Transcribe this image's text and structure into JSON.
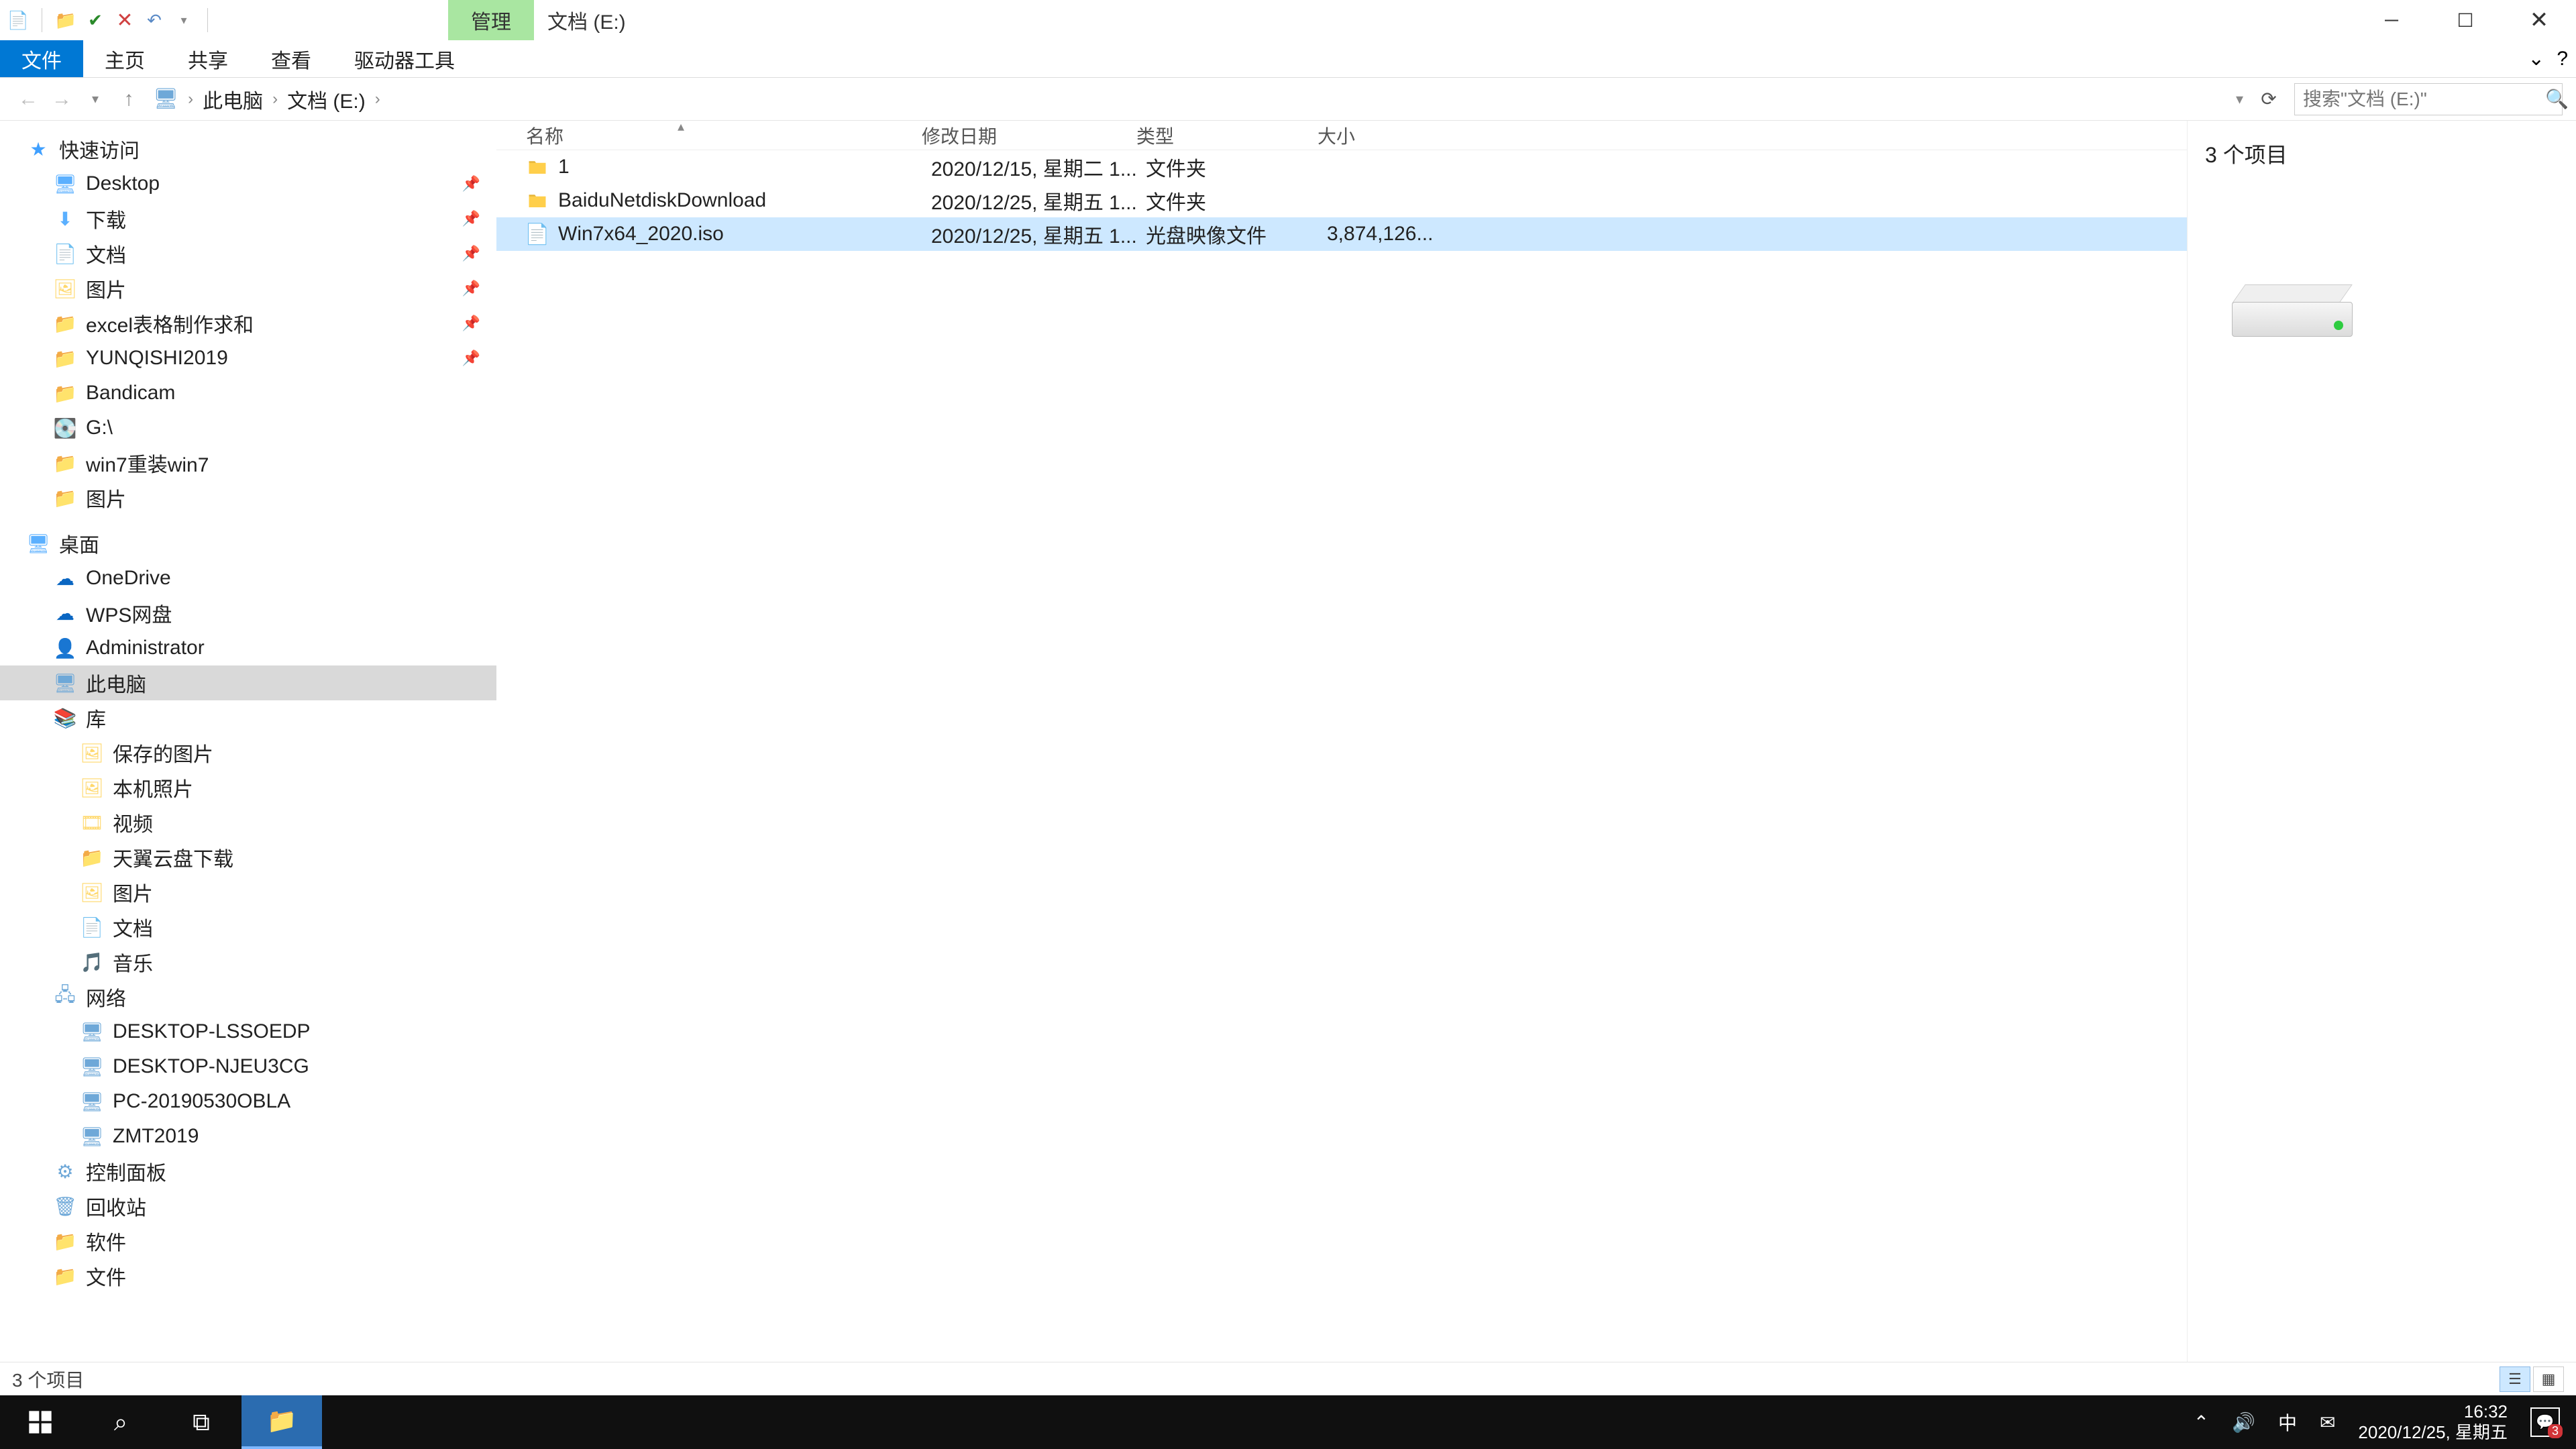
{
  "titlebar": {
    "contextual_tab": "管理",
    "window_title": "文档 (E:)"
  },
  "ribbon": {
    "file": "文件",
    "home": "主页",
    "share": "共享",
    "view": "查看",
    "drive_tools": "驱动器工具"
  },
  "breadcrumb": {
    "this_pc": "此电脑",
    "location": "文档 (E:)"
  },
  "search": {
    "placeholder": "搜索\"文档 (E:)\""
  },
  "tree": {
    "quick_access": "快速访问",
    "desktop": "Desktop",
    "downloads": "下载",
    "documents": "文档",
    "pictures": "图片",
    "excel": "excel表格制作求和",
    "yunqishi": "YUNQISHI2019",
    "bandicam": "Bandicam",
    "gdrive": "G:\\",
    "win7reinstall": "win7重装win7",
    "pictures2": "图片",
    "desktop_zh": "桌面",
    "onedrive": "OneDrive",
    "wps": "WPS网盘",
    "admin": "Administrator",
    "this_pc": "此电脑",
    "libraries": "库",
    "saved_pictures": "保存的图片",
    "camera_roll": "本机照片",
    "videos": "视频",
    "tianyi": "天翼云盘下载",
    "pics_lib": "图片",
    "docs_lib": "文档",
    "music": "音乐",
    "network": "网络",
    "pc1": "DESKTOP-LSSOEDP",
    "pc2": "DESKTOP-NJEU3CG",
    "pc3": "PC-20190530OBLA",
    "pc4": "ZMT2019",
    "control_panel": "控制面板",
    "recycle": "回收站",
    "software": "软件",
    "files": "文件"
  },
  "columns": {
    "name": "名称",
    "date": "修改日期",
    "type": "类型",
    "size": "大小"
  },
  "rows": [
    {
      "name": "1",
      "date": "2020/12/15, 星期二 1...",
      "type": "文件夹",
      "size": "",
      "kind": "folder"
    },
    {
      "name": "BaiduNetdiskDownload",
      "date": "2020/12/25, 星期五 1...",
      "type": "文件夹",
      "size": "",
      "kind": "folder"
    },
    {
      "name": "Win7x64_2020.iso",
      "date": "2020/12/25, 星期五 1...",
      "type": "光盘映像文件",
      "size": "3,874,126...",
      "kind": "file"
    }
  ],
  "preview": {
    "count_label": "3 个项目"
  },
  "statusbar": {
    "text": "3 个项目"
  },
  "taskbar": {
    "time": "16:32",
    "date": "2020/12/25, 星期五",
    "ime": "中",
    "notif_count": "3"
  }
}
